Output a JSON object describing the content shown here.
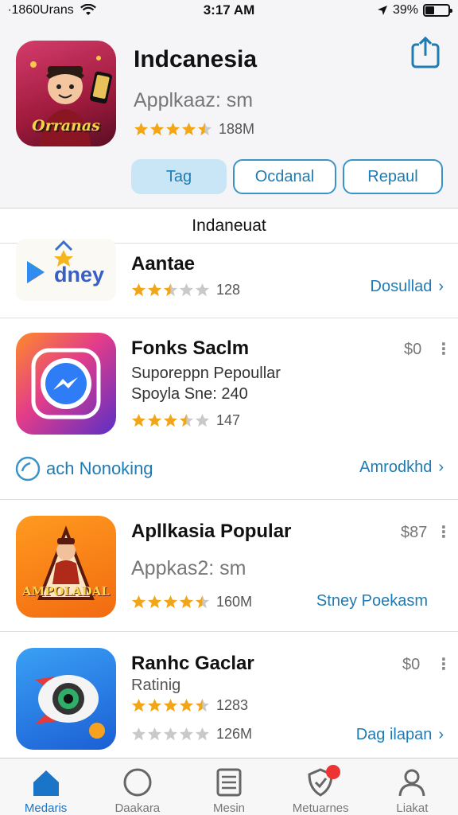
{
  "status": {
    "carrier": "∙1860Urans",
    "time": "3:17 AM",
    "battery_text": "39%",
    "battery_level": 0.39
  },
  "hero": {
    "title": "Indcanesia",
    "subtitle": "Applkaaz: sm",
    "rating": 4.5,
    "rating_count": "188M",
    "icon_text": "Orranas",
    "buttons": [
      {
        "label": "Tag",
        "active": true
      },
      {
        "label": "Ocdanal",
        "active": false
      },
      {
        "label": "Repaul",
        "active": false
      }
    ],
    "share_icon": "share-icon"
  },
  "section": {
    "title": "Indaneuat"
  },
  "apps": [
    {
      "title": "Aantae",
      "rating": 2.5,
      "count": "128",
      "link": "Dosullad",
      "icon_text": "dney"
    },
    {
      "title": "Fonks Saclm",
      "price": "$0",
      "line1": "Suporeppn Pepoullar",
      "line2": "Spoyla Sne: 240",
      "rating": 3.5,
      "count": "147",
      "extra_left": "ach Nonoking",
      "extra_right": "Amrodkhd"
    },
    {
      "title": "Apllkasia Popular",
      "price": "$87",
      "subtitle": "Appkas2: sm",
      "rating": 4.5,
      "count": "160M",
      "link": "Stney Poekasm",
      "icon_text": "AMPOLADAL"
    },
    {
      "title": "Ranhc Gaclar",
      "price": "$0",
      "line1": "Ratinig",
      "rating": 4.5,
      "count": "1283",
      "rating2": 0,
      "count2": "126M",
      "link": "Dag ilapan"
    }
  ],
  "tabs": [
    {
      "label": "Medaris",
      "icon": "home-icon",
      "active": true
    },
    {
      "label": "Daakara",
      "icon": "compass-icon",
      "active": false
    },
    {
      "label": "Mesin",
      "icon": "list-icon",
      "active": false
    },
    {
      "label": "Metuarnes",
      "icon": "shield-icon",
      "active": false,
      "badge": true
    },
    {
      "label": "Liakat",
      "icon": "person-icon",
      "active": false
    }
  ],
  "colors": {
    "accent": "#1f7bb3",
    "star": "#f2a516",
    "star_empty": "#c9c9c9",
    "tab_active": "#1a74c7"
  }
}
